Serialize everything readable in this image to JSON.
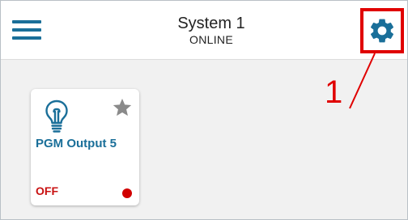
{
  "header": {
    "title": "System 1",
    "status": "ONLINE"
  },
  "annotation": {
    "number": "1"
  },
  "card": {
    "title": "PGM Output 5",
    "state": "OFF"
  },
  "colors": {
    "accent": "#1a6f99",
    "annotation_red": "#e00000",
    "off_red": "#c81010",
    "star_grey": "#8a8a8a"
  },
  "icons": {
    "menu": "hamburger-menu-icon",
    "settings": "gear-icon",
    "output": "lightbulb-icon",
    "favorite": "star-icon",
    "state_indicator": "red-dot"
  }
}
